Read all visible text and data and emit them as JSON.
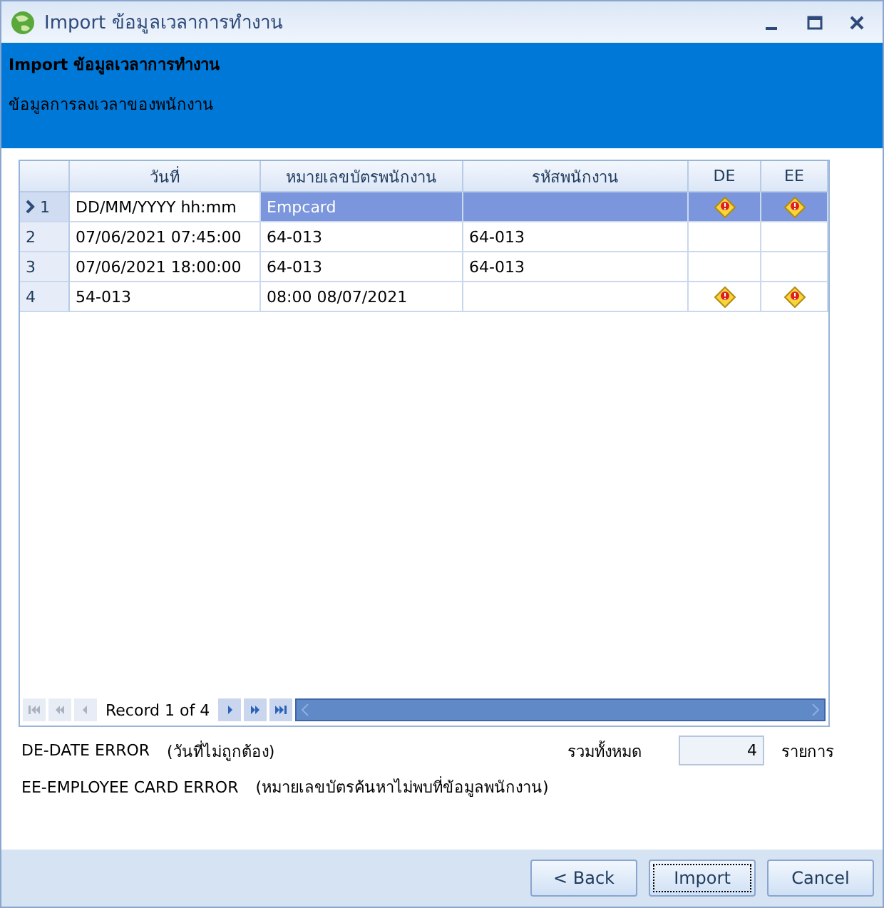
{
  "window": {
    "title": "Import ข้อมูลเวลาการทำงาน"
  },
  "header": {
    "title": "Import ข้อมูลเวลาการทำงาน",
    "subtitle": "ข้อมูลการลงเวลาของพนักงาน"
  },
  "table": {
    "columns": [
      "วันที่",
      "หมายเลขบัตรพนักงาน",
      "รหัสพนักงาน",
      "DE",
      "EE"
    ],
    "rows": [
      {
        "number": "1",
        "current": true,
        "selected": true,
        "date": "DD/MM/YYYY hh:mm",
        "card": "Empcard",
        "code": "",
        "de_error": true,
        "ee_error": true
      },
      {
        "number": "2",
        "current": false,
        "selected": false,
        "date": "07/06/2021 07:45:00",
        "card": "64-013",
        "code": "64-013",
        "de_error": false,
        "ee_error": false
      },
      {
        "number": "3",
        "current": false,
        "selected": false,
        "date": "07/06/2021 18:00:00",
        "card": "64-013",
        "code": "64-013",
        "de_error": false,
        "ee_error": false
      },
      {
        "number": "4",
        "current": false,
        "selected": false,
        "date": "54-013",
        "card": "08:00 08/07/2021",
        "code": "",
        "de_error": true,
        "ee_error": true
      }
    ]
  },
  "navigator": {
    "record_text": "Record 1 of 4"
  },
  "legend": [
    {
      "code": "DE-DATE ERROR",
      "description": "(วันที่ไม่ถูกต้อง)"
    },
    {
      "code": "EE-EMPLOYEE CARD ERROR",
      "description": "(หมายเลขบัตรค้นหาไม่พบที่ข้อมูลพนักงาน)"
    }
  ],
  "total": {
    "label": "รวมทั้งหมด",
    "value": "4",
    "unit": "รายการ"
  },
  "buttons": [
    {
      "label": "< Back",
      "focused": false
    },
    {
      "label": "Import",
      "focused": true
    },
    {
      "label": "Cancel",
      "focused": false
    }
  ]
}
